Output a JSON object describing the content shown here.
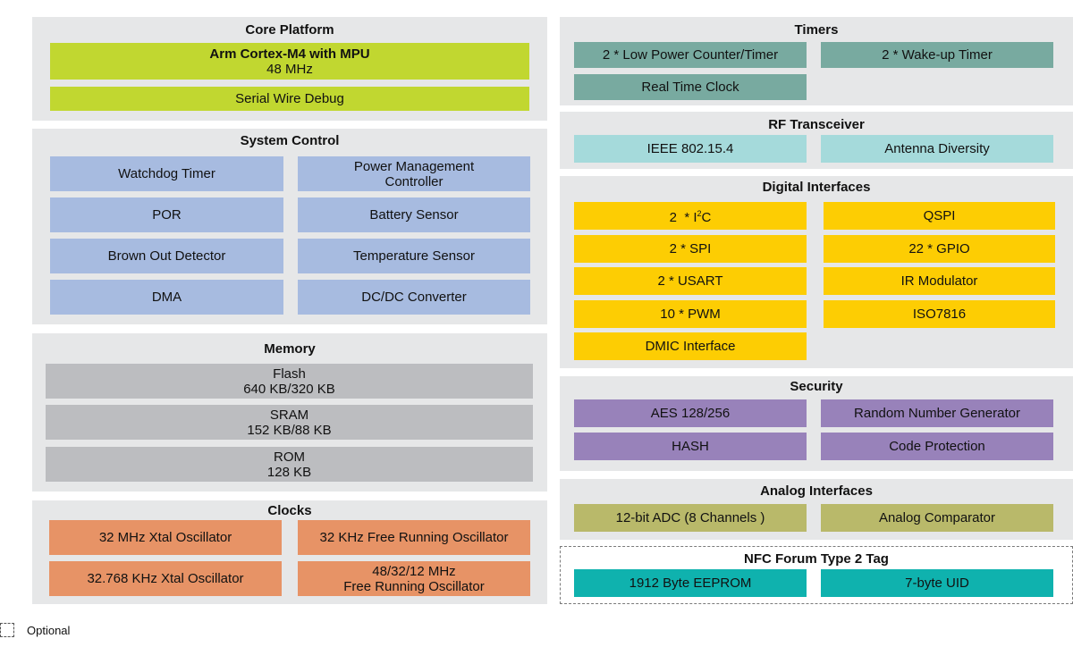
{
  "core_platform": {
    "title": "Core Platform",
    "cpu": {
      "name": "Arm Cortex-M4 with MPU",
      "freq": "48 MHz"
    },
    "debug": "Serial Wire Debug",
    "color": "#c1d730"
  },
  "system_control": {
    "title": "System Control",
    "color": "#a7bbe0",
    "items": [
      "Watchdog Timer",
      "Power Management",
      "Controller",
      "POR",
      "Battery Sensor",
      "Brown Out Detector",
      "Temperature Sensor",
      "DMA",
      "DC/DC Converter"
    ]
  },
  "memory": {
    "title": "Memory",
    "color": "#bcbdc0",
    "items": [
      {
        "name": "Flash",
        "size": "640 KB/320 KB"
      },
      {
        "name": "SRAM",
        "size": "152 KB/88 KB"
      },
      {
        "name": "ROM",
        "size": "128 KB"
      }
    ]
  },
  "clocks": {
    "title": "Clocks",
    "color": "#e79366",
    "items": [
      "32 MHz Xtal Oscillator",
      "32 KHz Free Running Oscillator",
      "32.768 KHz Xtal Oscillator",
      "48/32/12 MHz",
      "Free Running Oscillator"
    ]
  },
  "timers": {
    "title": "Timers",
    "color": "#78aaa0",
    "items": [
      "2 * Low Power Counter/Timer",
      "2 * Wake-up Timer",
      "Real Time Clock"
    ]
  },
  "rf": {
    "title": "RF Transceiver",
    "color": "#a5dadb",
    "items": [
      "IEEE 802.15.4",
      "Antenna Diversity"
    ]
  },
  "digital": {
    "title": "Digital Interfaces",
    "color": "#fdcd03",
    "i2c_prefix": "2  * I",
    "i2c_sup": "2",
    "i2c_suffix": "C",
    "items": [
      "QSPI",
      "2 * SPI",
      "22 * GPIO",
      "2 * USART",
      "IR Modulator",
      "10 * PWM",
      "ISO7816",
      "DMIC Interface"
    ]
  },
  "security": {
    "title": "Security",
    "color": "#9882ba",
    "items": [
      "AES 128/256",
      "Random Number Generator",
      "HASH",
      "Code Protection"
    ]
  },
  "analog": {
    "title": "Analog Interfaces",
    "color": "#b9b96a",
    "items": [
      "12-bit ADC (8 Channels )",
      "Analog Comparator"
    ]
  },
  "nfc": {
    "title": "NFC Forum Type 2 Tag",
    "color": "#0fb2ae",
    "optional": true,
    "items": [
      "1912 Byte EEPROM",
      "7-byte UID"
    ]
  },
  "legend": {
    "label": "Optional",
    "icon": "dashed-box-icon"
  }
}
